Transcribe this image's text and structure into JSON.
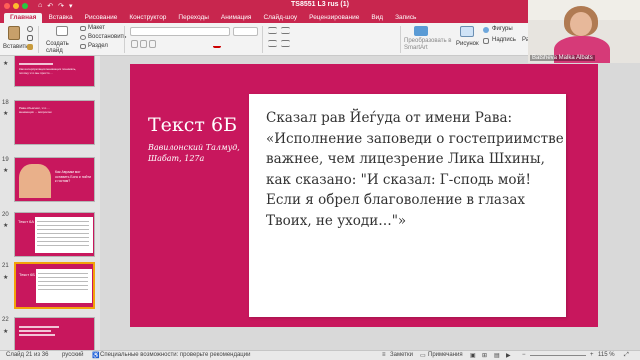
{
  "window": {
    "title": "TS8551 L3 rus (1)",
    "quick_access": [
      "⌂",
      "↶",
      "↷",
      "▾"
    ]
  },
  "tabs": [
    "Главная",
    "Вставка",
    "Рисование",
    "Конструктор",
    "Переходы",
    "Анимация",
    "Слайд-шоу",
    "Рецензирование",
    "Вид",
    "Запись"
  ],
  "ribbon": {
    "paste": "Вставить",
    "create_slide": "Создать слайд",
    "layout": "Макет",
    "reset": "Восстановить",
    "section": "Раздел",
    "smartart": "Преобразовать в SmartArt",
    "picture": "Рисунок",
    "shapes": "Фигуры",
    "textbox": "Надпись",
    "rearrange": "Раз"
  },
  "thumbnails": [
    {
      "num": "",
      "text": "Как интерпретация меняющих понимать, потому что мы просто ..."
    },
    {
      "num": "18",
      "text": "Рава объяснил, что ... меняющих ... вопросом"
    },
    {
      "num": "19",
      "text": "Как Авраам мог оставить Бога и пойти к гостям?"
    },
    {
      "num": "20",
      "text": "Текст 6А"
    },
    {
      "num": "21",
      "text": "Текст 6Б"
    },
    {
      "num": "22",
      "text": ""
    }
  ],
  "slide": {
    "title": "Текст 6Б",
    "source": "Вавилонский Талмуд, Шабат, 127а",
    "body": "Сказал рав Йеѓуда от имени Рава: «Исполнение заповеди о гостеприимстве важнее, чем лицезрение Лика Шхины, как сказано: \"И сказал: Г-сподь мой! Если я обрел благоволение в глазах Твоих, не уходи…\"»"
  },
  "status": {
    "slide_counter": "Слайд 21 из 36",
    "language": "русский",
    "accessibility": "Специальные возможности: проверьте рекомендации",
    "notes": "Заметки",
    "comments": "Примечания",
    "zoom": "115 %"
  },
  "webcam": {
    "name": "Batsheva Malka Albats"
  },
  "colors": {
    "accent": "#c8264e",
    "slide_bg": "#c8175d",
    "selection": "#f2a30a"
  }
}
